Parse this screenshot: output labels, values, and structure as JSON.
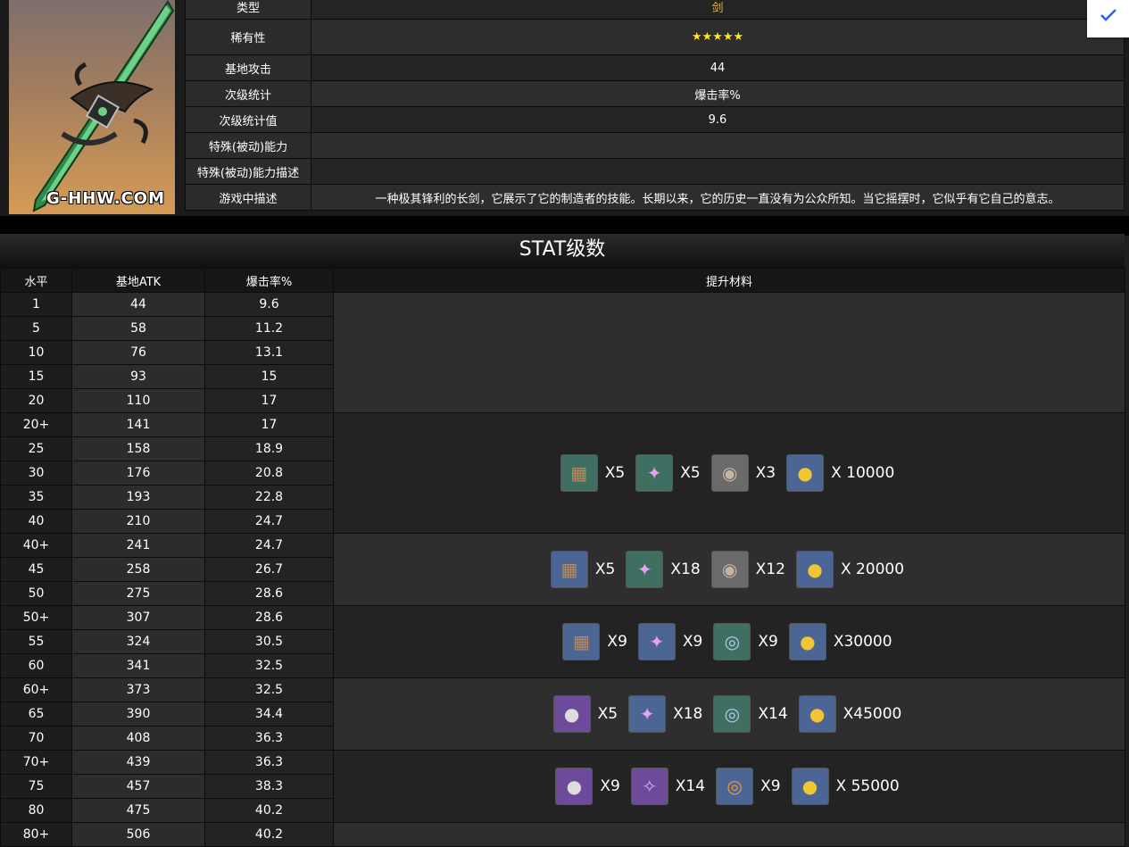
{
  "info_rows": [
    {
      "label": "类型",
      "value": "剑"
    },
    {
      "label": "稀有性",
      "value": "★★★★★"
    },
    {
      "label": "基地攻击",
      "value": "44"
    },
    {
      "label": "次级统计",
      "value": "爆击率%"
    },
    {
      "label": "次级统计值",
      "value": "9.6"
    },
    {
      "label": "特殊(被动)能力",
      "value": ""
    },
    {
      "label": "特殊(被动)能力描述",
      "value": ""
    },
    {
      "label": "游戏中描述",
      "value": "一种极其锋利的长剑，它展示了它的制造者的技能。长期以来，它的历史一直没有为公众所知。当它摇摆时，它似乎有它自己的意志。"
    }
  ],
  "watermark": "G-HHW.COM",
  "checkbox_icon": "check-icon",
  "stat_title": "STAT级数",
  "headers": [
    "水平",
    "基地ATK",
    "爆击率%",
    "提升材料"
  ],
  "rows": [
    [
      "1",
      "44",
      "9.6"
    ],
    [
      "5",
      "58",
      "11.2"
    ],
    [
      "10",
      "76",
      "13.1"
    ],
    [
      "15",
      "93",
      "15"
    ],
    [
      "20",
      "110",
      "17"
    ],
    [
      "20+",
      "141",
      "17"
    ],
    [
      "25",
      "158",
      "18.9"
    ],
    [
      "30",
      "176",
      "20.8"
    ],
    [
      "35",
      "193",
      "22.8"
    ],
    [
      "40",
      "210",
      "24.7"
    ],
    [
      "40+",
      "241",
      "24.7"
    ],
    [
      "45",
      "258",
      "26.7"
    ],
    [
      "50",
      "275",
      "28.6"
    ],
    [
      "50+",
      "307",
      "28.6"
    ],
    [
      "55",
      "324",
      "30.5"
    ],
    [
      "60",
      "341",
      "32.5"
    ],
    [
      "60+",
      "373",
      "32.5"
    ],
    [
      "65",
      "390",
      "34.4"
    ],
    [
      "70",
      "408",
      "36.3"
    ],
    [
      "70+",
      "439",
      "36.3"
    ],
    [
      "75",
      "457",
      "38.3"
    ],
    [
      "80",
      "475",
      "40.2"
    ],
    [
      "80+",
      "506",
      "40.2"
    ]
  ],
  "materials": [
    [],
    [
      {
        "icon": "bench-stones-icon",
        "color": "#3f6e62",
        "qty": "X5"
      },
      {
        "icon": "pink-crystal-icon",
        "color": "#3f6e62",
        "qty": "X5"
      },
      {
        "icon": "grey-disc-icon",
        "color": "#6a6a6a",
        "qty": "X3"
      },
      {
        "icon": "mora-coin-icon",
        "color": "#4b6595",
        "qty": "X 10000"
      }
    ],
    [
      {
        "icon": "bench-stones-icon",
        "color": "#4b6595",
        "qty": "X5"
      },
      {
        "icon": "pink-crystal-icon",
        "color": "#3f6e62",
        "qty": "X18"
      },
      {
        "icon": "grey-disc-icon",
        "color": "#6a6a6a",
        "qty": "X12"
      },
      {
        "icon": "mora-coin-icon",
        "color": "#4b6595",
        "qty": "X 20000"
      }
    ],
    [
      {
        "icon": "bench-stones-icon",
        "color": "#4b6595",
        "qty": "X9"
      },
      {
        "icon": "pink-crystal-icon",
        "color": "#4b6595",
        "qty": "X9"
      },
      {
        "icon": "blue-swirl-icon",
        "color": "#3f6e62",
        "qty": "X9"
      },
      {
        "icon": "mora-coin-icon",
        "color": "#4b6595",
        "qty": "X30000"
      }
    ],
    [
      {
        "icon": "pearl-bench-icon",
        "color": "#6e4a9a",
        "qty": "X5"
      },
      {
        "icon": "pink-crystal-icon",
        "color": "#4b6595",
        "qty": "X18"
      },
      {
        "icon": "blue-swirl-icon",
        "color": "#3f6e62",
        "qty": "X14"
      },
      {
        "icon": "mora-coin-icon",
        "color": "#4b6595",
        "qty": "X45000"
      }
    ],
    [
      {
        "icon": "pearl-bench-icon",
        "color": "#6e4a9a",
        "qty": "X9"
      },
      {
        "icon": "purple-crystal-icon",
        "color": "#6e4a9a",
        "qty": "X14"
      },
      {
        "icon": "orange-swirl-icon",
        "color": "#4b6595",
        "qty": "X9"
      },
      {
        "icon": "mora-coin-icon",
        "color": "#4b6595",
        "qty": "X 55000"
      }
    ]
  ]
}
